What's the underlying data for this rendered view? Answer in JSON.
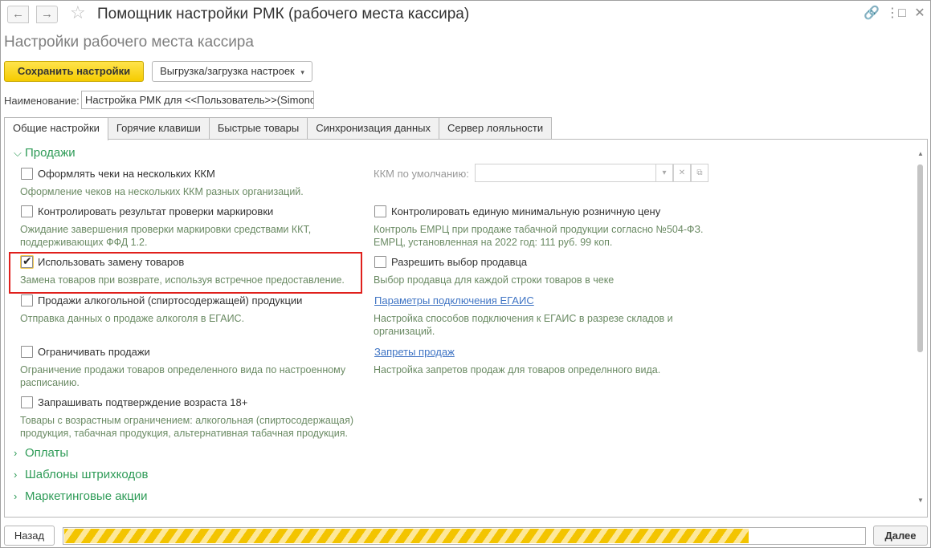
{
  "window": {
    "title": "Помощник настройки РМК (рабочего места кассира)",
    "subtitle": "Настройки рабочего места кассира",
    "icons": [
      "back-arrow-icon",
      "forward-arrow-icon",
      "star-icon",
      "link-icon",
      "more-icon",
      "maximize-icon",
      "close-icon"
    ],
    "back_glyph": "←",
    "fwd_glyph": "→",
    "star_glyph": "☆",
    "link_glyph": "🔗",
    "more_glyph": "⋮",
    "max_glyph": "□",
    "close_glyph": "✕"
  },
  "toolbar": {
    "save_label": "Сохранить настройки",
    "export_label": "Выгрузка/загрузка настроек",
    "export_arrow": "▾"
  },
  "name_field": {
    "label": "Наименование:",
    "value": "Настройка РМК для <<Пользователь>>(Simonov"
  },
  "tabs": [
    {
      "label": "Общие настройки",
      "active": true
    },
    {
      "label": "Горячие клавиши",
      "active": false
    },
    {
      "label": "Быстрые товары",
      "active": false
    },
    {
      "label": "Синхронизация данных",
      "active": false
    },
    {
      "label": "Сервер лояльности",
      "active": false
    }
  ],
  "sections": {
    "sales": {
      "title": "Продажи",
      "chev": "⌵"
    },
    "payments": {
      "title": "Оплаты",
      "chev": "›"
    },
    "barcodes": {
      "title": "Шаблоны штрихкодов",
      "chev": "›"
    },
    "marketing": {
      "title": "Маркетинговые акции",
      "chev": "›"
    }
  },
  "left_options": [
    {
      "label": "Оформлять чеки на нескольких ККМ",
      "hint": "Оформление чеков на нескольких ККМ разных организаций.",
      "checked": false
    },
    {
      "label": "Контролировать результат проверки маркировки",
      "hint": "Ожидание завершения проверки маркировки средствами ККТ, поддерживающих ФФД 1.2.",
      "checked": false
    },
    {
      "label": "Использовать замену товаров",
      "hint": "Замена товаров при возврате, используя встречное предоставление.",
      "checked": true
    },
    {
      "label": "Продажи алкогольной (спиртосодержащей) продукции",
      "hint": "Отправка данных о продаже алкоголя в ЕГАИС.",
      "checked": false
    },
    {
      "label": "Ограничивать продажи",
      "hint": "Ограничение продажи товаров определенного вида по настроенному расписанию.",
      "checked": false
    },
    {
      "label": "Запрашивать подтверждение возраста 18+",
      "hint": "Товары с возрастным ограничением: алкогольная (спиртосодержащая) продукция, табачная продукция, альтернативная табачная продукция.",
      "checked": false
    }
  ],
  "right": {
    "kkm_label": "ККМ по умолчанию:",
    "kkm_value": "",
    "kkm_dropdown_glyph": "▾",
    "kkm_clear_glyph": "✕",
    "kkm_open_glyph": "⧉",
    "min_price": {
      "label": "Контролировать единую минимальную розничную цену",
      "hint": "Контроль ЕМРЦ при продаже табачной продукции согласно №504-ФЗ. ЕМРЦ, установленная на 2022 год: 111 руб. 99 коп.",
      "checked": false
    },
    "seller": {
      "label": "Разрешить выбор продавца",
      "hint": "Выбор продавца для каждой строки товаров в чеке",
      "checked": false
    },
    "egais": {
      "link": "Параметры подключения ЕГАИС",
      "hint": "Настройка способов подключения к ЕГАИС в разрезе складов и организаций."
    },
    "bans": {
      "link": "Запреты продаж",
      "hint": "Настройка запретов продаж для товаров определнного вида."
    }
  },
  "scrollbar": {
    "up": "▲",
    "down": "▼"
  },
  "footer": {
    "back_label": "Назад",
    "next_label": "Далее",
    "progress": 0.855
  },
  "colors": {
    "accent": "#f5cc00",
    "section": "#2e9b57",
    "hint": "#6a8a63",
    "link": "#3f74c4",
    "highlight": "#e0201c"
  }
}
